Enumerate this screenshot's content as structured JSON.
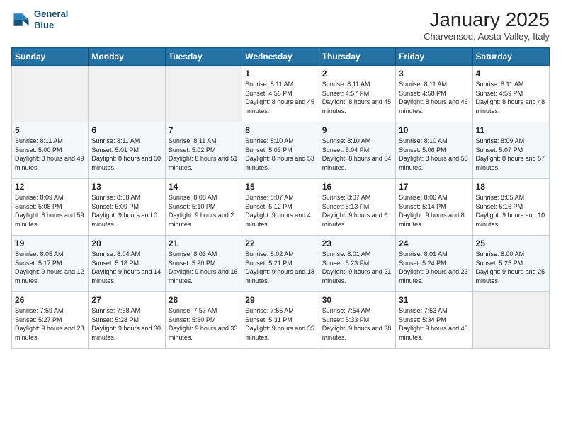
{
  "logo": {
    "line1": "General",
    "line2": "Blue"
  },
  "title": "January 2025",
  "subtitle": "Charvensod, Aosta Valley, Italy",
  "weekdays": [
    "Sunday",
    "Monday",
    "Tuesday",
    "Wednesday",
    "Thursday",
    "Friday",
    "Saturday"
  ],
  "weeks": [
    [
      {
        "day": "",
        "sunrise": "",
        "sunset": "",
        "daylight": ""
      },
      {
        "day": "",
        "sunrise": "",
        "sunset": "",
        "daylight": ""
      },
      {
        "day": "",
        "sunrise": "",
        "sunset": "",
        "daylight": ""
      },
      {
        "day": "1",
        "sunrise": "Sunrise: 8:11 AM",
        "sunset": "Sunset: 4:56 PM",
        "daylight": "Daylight: 8 hours and 45 minutes."
      },
      {
        "day": "2",
        "sunrise": "Sunrise: 8:11 AM",
        "sunset": "Sunset: 4:57 PM",
        "daylight": "Daylight: 8 hours and 45 minutes."
      },
      {
        "day": "3",
        "sunrise": "Sunrise: 8:11 AM",
        "sunset": "Sunset: 4:58 PM",
        "daylight": "Daylight: 8 hours and 46 minutes."
      },
      {
        "day": "4",
        "sunrise": "Sunrise: 8:11 AM",
        "sunset": "Sunset: 4:59 PM",
        "daylight": "Daylight: 8 hours and 48 minutes."
      }
    ],
    [
      {
        "day": "5",
        "sunrise": "Sunrise: 8:11 AM",
        "sunset": "Sunset: 5:00 PM",
        "daylight": "Daylight: 8 hours and 49 minutes."
      },
      {
        "day": "6",
        "sunrise": "Sunrise: 8:11 AM",
        "sunset": "Sunset: 5:01 PM",
        "daylight": "Daylight: 8 hours and 50 minutes."
      },
      {
        "day": "7",
        "sunrise": "Sunrise: 8:11 AM",
        "sunset": "Sunset: 5:02 PM",
        "daylight": "Daylight: 8 hours and 51 minutes."
      },
      {
        "day": "8",
        "sunrise": "Sunrise: 8:10 AM",
        "sunset": "Sunset: 5:03 PM",
        "daylight": "Daylight: 8 hours and 53 minutes."
      },
      {
        "day": "9",
        "sunrise": "Sunrise: 8:10 AM",
        "sunset": "Sunset: 5:04 PM",
        "daylight": "Daylight: 8 hours and 54 minutes."
      },
      {
        "day": "10",
        "sunrise": "Sunrise: 8:10 AM",
        "sunset": "Sunset: 5:06 PM",
        "daylight": "Daylight: 8 hours and 55 minutes."
      },
      {
        "day": "11",
        "sunrise": "Sunrise: 8:09 AM",
        "sunset": "Sunset: 5:07 PM",
        "daylight": "Daylight: 8 hours and 57 minutes."
      }
    ],
    [
      {
        "day": "12",
        "sunrise": "Sunrise: 8:09 AM",
        "sunset": "Sunset: 5:08 PM",
        "daylight": "Daylight: 8 hours and 59 minutes."
      },
      {
        "day": "13",
        "sunrise": "Sunrise: 8:08 AM",
        "sunset": "Sunset: 5:09 PM",
        "daylight": "Daylight: 9 hours and 0 minutes."
      },
      {
        "day": "14",
        "sunrise": "Sunrise: 8:08 AM",
        "sunset": "Sunset: 5:10 PM",
        "daylight": "Daylight: 9 hours and 2 minutes."
      },
      {
        "day": "15",
        "sunrise": "Sunrise: 8:07 AM",
        "sunset": "Sunset: 5:12 PM",
        "daylight": "Daylight: 9 hours and 4 minutes."
      },
      {
        "day": "16",
        "sunrise": "Sunrise: 8:07 AM",
        "sunset": "Sunset: 5:13 PM",
        "daylight": "Daylight: 9 hours and 6 minutes."
      },
      {
        "day": "17",
        "sunrise": "Sunrise: 8:06 AM",
        "sunset": "Sunset: 5:14 PM",
        "daylight": "Daylight: 9 hours and 8 minutes."
      },
      {
        "day": "18",
        "sunrise": "Sunrise: 8:05 AM",
        "sunset": "Sunset: 5:16 PM",
        "daylight": "Daylight: 9 hours and 10 minutes."
      }
    ],
    [
      {
        "day": "19",
        "sunrise": "Sunrise: 8:05 AM",
        "sunset": "Sunset: 5:17 PM",
        "daylight": "Daylight: 9 hours and 12 minutes."
      },
      {
        "day": "20",
        "sunrise": "Sunrise: 8:04 AM",
        "sunset": "Sunset: 5:18 PM",
        "daylight": "Daylight: 9 hours and 14 minutes."
      },
      {
        "day": "21",
        "sunrise": "Sunrise: 8:03 AM",
        "sunset": "Sunset: 5:20 PM",
        "daylight": "Daylight: 9 hours and 16 minutes."
      },
      {
        "day": "22",
        "sunrise": "Sunrise: 8:02 AM",
        "sunset": "Sunset: 5:21 PM",
        "daylight": "Daylight: 9 hours and 18 minutes."
      },
      {
        "day": "23",
        "sunrise": "Sunrise: 8:01 AM",
        "sunset": "Sunset: 5:23 PM",
        "daylight": "Daylight: 9 hours and 21 minutes."
      },
      {
        "day": "24",
        "sunrise": "Sunrise: 8:01 AM",
        "sunset": "Sunset: 5:24 PM",
        "daylight": "Daylight: 9 hours and 23 minutes."
      },
      {
        "day": "25",
        "sunrise": "Sunrise: 8:00 AM",
        "sunset": "Sunset: 5:25 PM",
        "daylight": "Daylight: 9 hours and 25 minutes."
      }
    ],
    [
      {
        "day": "26",
        "sunrise": "Sunrise: 7:59 AM",
        "sunset": "Sunset: 5:27 PM",
        "daylight": "Daylight: 9 hours and 28 minutes."
      },
      {
        "day": "27",
        "sunrise": "Sunrise: 7:58 AM",
        "sunset": "Sunset: 5:28 PM",
        "daylight": "Daylight: 9 hours and 30 minutes."
      },
      {
        "day": "28",
        "sunrise": "Sunrise: 7:57 AM",
        "sunset": "Sunset: 5:30 PM",
        "daylight": "Daylight: 9 hours and 33 minutes."
      },
      {
        "day": "29",
        "sunrise": "Sunrise: 7:55 AM",
        "sunset": "Sunset: 5:31 PM",
        "daylight": "Daylight: 9 hours and 35 minutes."
      },
      {
        "day": "30",
        "sunrise": "Sunrise: 7:54 AM",
        "sunset": "Sunset: 5:33 PM",
        "daylight": "Daylight: 9 hours and 38 minutes."
      },
      {
        "day": "31",
        "sunrise": "Sunrise: 7:53 AM",
        "sunset": "Sunset: 5:34 PM",
        "daylight": "Daylight: 9 hours and 40 minutes."
      },
      {
        "day": "",
        "sunrise": "",
        "sunset": "",
        "daylight": ""
      }
    ]
  ]
}
